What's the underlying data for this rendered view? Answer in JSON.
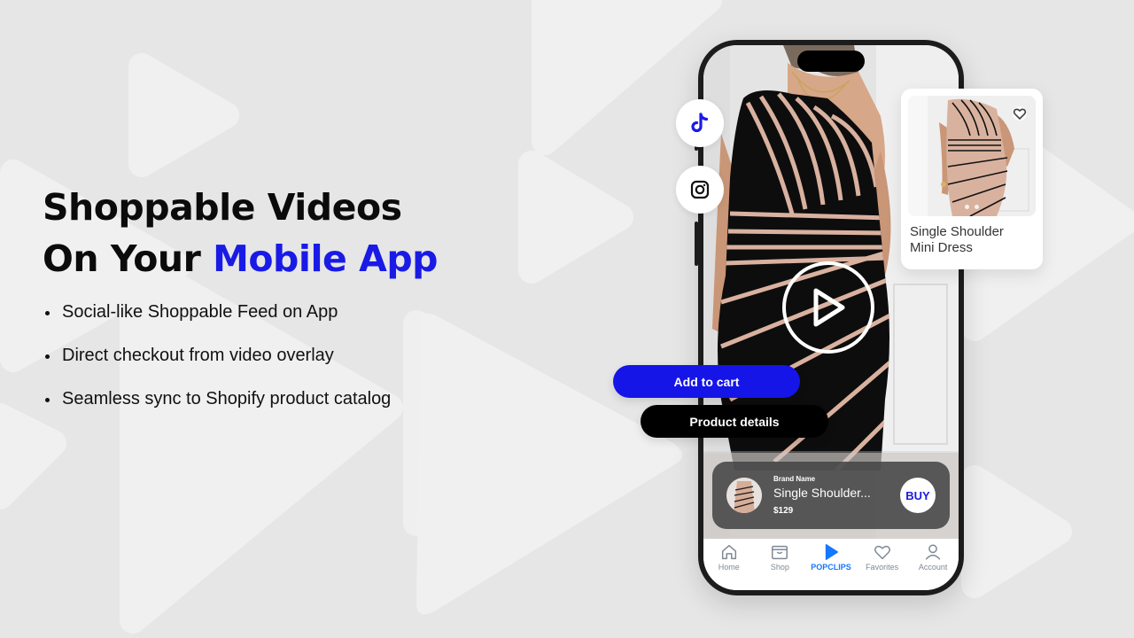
{
  "hero": {
    "title_line1": "Shoppable Videos",
    "title_line2_prefix": "On Your ",
    "title_line2_accent": "Mobile App",
    "bullets": [
      "Social-like Shoppable Feed on App",
      "Direct checkout from video overlay",
      "Seamless sync to Shopify product catalog"
    ]
  },
  "social": {
    "tiktok_icon": "tiktok-icon",
    "instagram_icon": "instagram-icon"
  },
  "product_card": {
    "title_line1": "Single Shoulder",
    "title_line2": "Mini Dress",
    "carousel_dots": 2
  },
  "actions": {
    "add_to_cart": "Add to cart",
    "product_details": "Product details"
  },
  "product_bar": {
    "brand": "Brand Name",
    "name": "Single Shoulder...",
    "price": "$129",
    "buy_label": "BUY"
  },
  "tabbar": {
    "items": [
      {
        "label": "Home",
        "icon": "home-icon"
      },
      {
        "label": "Shop",
        "icon": "shop-icon"
      },
      {
        "label": "POPCLIPS",
        "icon": "play-icon",
        "active": true
      },
      {
        "label": "Favorites",
        "icon": "heart-icon"
      },
      {
        "label": "Account",
        "icon": "user-icon"
      }
    ]
  },
  "colors": {
    "accent": "#1a1ae6",
    "cart_button": "#1515e8",
    "active_tab": "#1677ff",
    "background": "#e6e6e6"
  }
}
